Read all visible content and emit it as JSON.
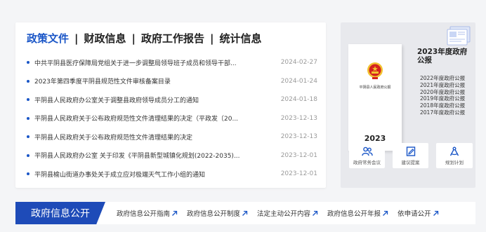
{
  "news_panel": {
    "tabs": [
      {
        "label": "政策文件"
      },
      {
        "label": "财政信息"
      },
      {
        "label": "政府工作报告"
      },
      {
        "label": "统计信息"
      }
    ],
    "separator": "|",
    "items": [
      {
        "title": "中共平阴县医疗保障局党组关于进一步调整局领导班子成员和领导干部...",
        "date": "2024-02-27"
      },
      {
        "title": "2023年第四季度平阴县规范性文件审核备案目录",
        "date": "2024-01-24"
      },
      {
        "title": "平阴县人民政府办公室关于调整县政府领导成员分工的通知",
        "date": "2024-01-18"
      },
      {
        "title": "平阴县人民政府关于公布政府规范性文件清理结果的决定（平政发〔20...",
        "date": "2023-12-13"
      },
      {
        "title": "平阴县人民政府关于公布政府规范性文件清理结果的决定",
        "date": "2023-12-13"
      },
      {
        "title": "平阴县人民政府办公室 关于印发《平阴县新型城镇化规划(2022-2035)...",
        "date": "2023-12-01"
      },
      {
        "title": "平阴县榆山街道办事处关于成立应对极端天气工作小组的通知",
        "date": "2023-12-01"
      }
    ]
  },
  "bulletin": {
    "cover_caption": "平阴县人民政府公报",
    "cover_year": "2023",
    "title": "2023年度政府公报",
    "years": [
      "2022年度政府公报",
      "2021年度政府公报",
      "2020年度政府公报",
      "2019年度政府公报",
      "2018年度政府公报",
      "2017年度政府公报"
    ],
    "quick_links": [
      {
        "label": "政府常务会议",
        "icon": "people-icon"
      },
      {
        "label": "建议提案",
        "icon": "edit-doc-icon"
      },
      {
        "label": "规划计划",
        "icon": "compass-icon"
      }
    ]
  },
  "info_bar": {
    "title": "政府信息公开",
    "links": [
      {
        "label": "政府信息公开指南"
      },
      {
        "label": "政府信息公开制度"
      },
      {
        "label": "法定主动公开内容"
      },
      {
        "label": "政府信息公开年报"
      },
      {
        "label": "依申请公开"
      }
    ]
  },
  "colors": {
    "accent": "#1a56c7",
    "bar_blue": "#1e4bb8",
    "emblem_red": "#d4231e",
    "emblem_gold": "#f2c230"
  }
}
